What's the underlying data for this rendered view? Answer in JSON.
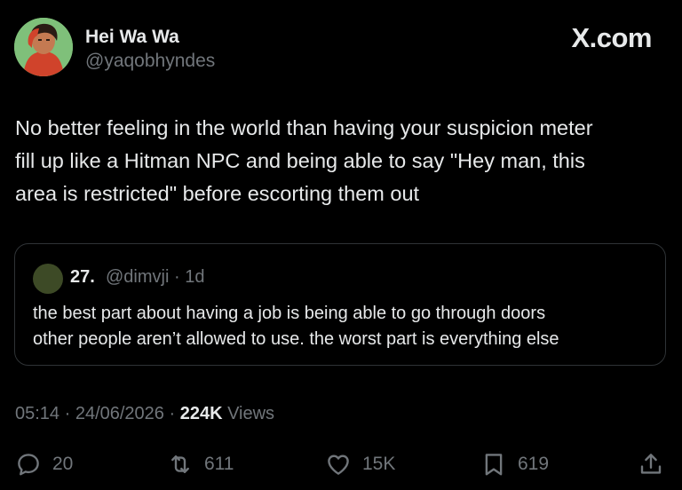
{
  "author": {
    "name": "Hei Wa Wa",
    "handle": "@yaqobhyndes"
  },
  "brand": "X.com",
  "tweet": {
    "lines": [
      "No better feeling in the world than having your suspicion meter",
      "fill up like a Hitman NPC and being able to say \"Hey man, this",
      "area is restricted\" before escorting them out"
    ]
  },
  "quote": {
    "name": "27.",
    "handle": "@dimvji · 1d",
    "lines": [
      "the best part about having a job is being able to go through doors",
      "other people aren’t allowed to use. the worst part is everything else"
    ]
  },
  "meta": {
    "time": "05:14 · 24/06/2026 · ",
    "views_count": "224K",
    "views_label": " Views"
  },
  "actions": {
    "replies": "20",
    "reposts": "611",
    "likes": "15K",
    "bookmarks": "619"
  },
  "icons": [
    "reply-icon",
    "repost-icon",
    "like-icon",
    "bookmark-icon",
    "share-icon"
  ]
}
